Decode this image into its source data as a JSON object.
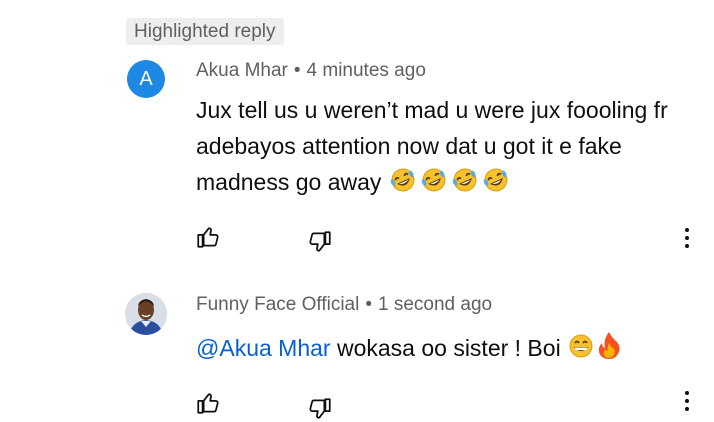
{
  "highlighted_label": "Highlighted reply",
  "comments": [
    {
      "avatar_letter": "A",
      "author": "Akua Mhar",
      "separator": "•",
      "time": "4 minutes ago",
      "text": "Jux tell us u weren’t mad u were jux foooling fr adebayos attention now dat u got it e fake madness go away",
      "emojis": [
        "rofl-emoji",
        "rofl-emoji",
        "rofl-emoji",
        "rofl-emoji"
      ],
      "avatar_color": "#1e88e5"
    },
    {
      "author": "Funny Face Official",
      "separator": "•",
      "time": "1 second ago",
      "mention": "@Akua Mhar",
      "text": " wokasa oo sister ! Boi ",
      "emojis": [
        "grin-emoji",
        "fire-emoji"
      ]
    }
  ],
  "icons": {
    "like": "thumbs-up-icon",
    "dislike": "thumbs-down-icon",
    "more": "more-vert-icon"
  },
  "colors": {
    "mention": "#065fd4",
    "meta": "#606060",
    "text": "#0f0f0f"
  }
}
